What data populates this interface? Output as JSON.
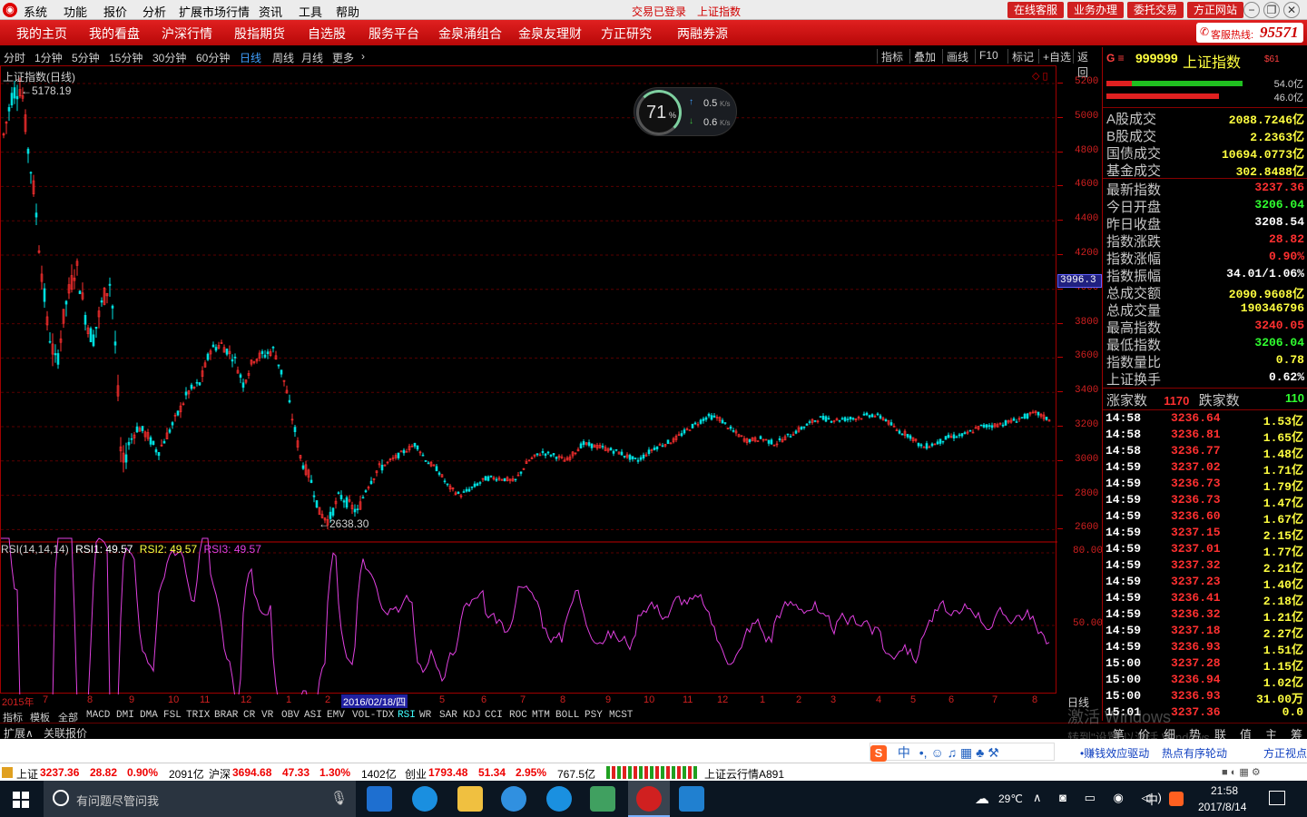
{
  "menubar": {
    "items": [
      "系统",
      "功能",
      "报价",
      "分析",
      "扩展市场行情",
      "资讯",
      "工具",
      "帮助"
    ],
    "status": "交易已登录",
    "title": "上证指数",
    "buttons": [
      "在线客服",
      "业务办理",
      "委托交易",
      "方正网站"
    ]
  },
  "navbar": {
    "items": [
      "我的主页",
      "我的看盘",
      "沪深行情",
      "股指期货",
      "自选股",
      "服务平台",
      "金泉涌组合",
      "金泉友理财",
      "方正研究",
      "两融券源"
    ],
    "hotline_label": "客服热线:",
    "hotline": "95571"
  },
  "periods": [
    "分时",
    "1分钟",
    "5分钟",
    "15分钟",
    "30分钟",
    "60分钟",
    "日线",
    "周线",
    "月线",
    "更多"
  ],
  "period_active": "日线",
  "tools": [
    "指标",
    "叠加",
    "画线",
    "F10",
    "标记",
    "+自选",
    "返回"
  ],
  "chart": {
    "title": "上证指数(日线)",
    "high_label": "5178.19",
    "low_label": "2638.30",
    "cursor_value": "3996.3",
    "y_ticks": [
      "5200",
      "5000",
      "4800",
      "4600",
      "4400",
      "4200",
      "4000",
      "3800",
      "3600",
      "3400",
      "3200",
      "3000",
      "2800",
      "2600"
    ],
    "rsi_title": "RSI(14,14,14)",
    "rsi1": "RSI1: 49.57",
    "rsi2": "RSI2: 49.57",
    "rsi3": "RSI3: 49.57",
    "rsi_ticks": [
      "80.00",
      "50.00"
    ],
    "date_labels": [
      "2015年",
      "7",
      "8",
      "9",
      "10",
      "11",
      "12",
      "1",
      "2",
      "2016/02/18/四",
      "5",
      "6",
      "7",
      "8",
      "9",
      "10",
      "11",
      "12",
      "1",
      "2",
      "3",
      "4",
      "5",
      "6",
      "7",
      "8"
    ],
    "period_footer": "日线"
  },
  "speed_widget": {
    "percent": "71",
    "unit": "%",
    "up": "0.5",
    "down": "0.6",
    "speed_unit": "K/s"
  },
  "indicators": [
    "指标",
    "模板",
    "全部",
    "MACD",
    "DMI",
    "DMA",
    "FSL",
    "TRIX",
    "BRAR",
    "CR",
    "VR",
    "OBV",
    "ASI",
    "EMV",
    "VOL-TDX",
    "RSI",
    "WR",
    "SAR",
    "KDJ",
    "CCI",
    "ROC",
    "MTM",
    "BOLL",
    "PSY",
    "MCST"
  ],
  "indicator_active": "RSI",
  "subtabs": [
    "扩展∧",
    "关联报价"
  ],
  "right_panel": {
    "code": "999999",
    "name": "上证指数",
    "tag": "$61",
    "bar_top": "54.0亿",
    "bar_bottom": "46.0亿",
    "rows1": [
      {
        "label": "A股成交",
        "value": "2088.7246亿"
      },
      {
        "label": "B股成交",
        "value": "2.2363亿"
      },
      {
        "label": "国债成交",
        "value": "10694.0773亿"
      },
      {
        "label": "基金成交",
        "value": "302.8488亿"
      }
    ],
    "rows2": [
      {
        "label": "最新指数",
        "value": "3237.36",
        "color": "#ff3030"
      },
      {
        "label": "今日开盘",
        "value": "3206.04",
        "color": "#30ff30"
      },
      {
        "label": "昨日收盘",
        "value": "3208.54",
        "color": "#ffffff"
      },
      {
        "label": "指数涨跌",
        "value": "28.82",
        "color": "#ff3030"
      },
      {
        "label": "指数涨幅",
        "value": "0.90%",
        "color": "#ff3030"
      },
      {
        "label": "指数振幅",
        "value": "34.01/1.06%",
        "color": "#ffffff"
      },
      {
        "label": "总成交额",
        "value": "2090.9608亿",
        "color": "#ffff40"
      },
      {
        "label": "总成交量",
        "value": "190346796",
        "color": "#ffff40"
      },
      {
        "label": "最高指数",
        "value": "3240.05",
        "color": "#ff3030"
      },
      {
        "label": "最低指数",
        "value": "3206.04",
        "color": "#30ff30"
      },
      {
        "label": "指数量比",
        "value": "0.78",
        "color": "#ffff40"
      },
      {
        "label": "上证换手",
        "value": "0.62%",
        "color": "#ffffff"
      }
    ],
    "up_label": "涨家数",
    "up_count": "1170",
    "down_label": "跌家数",
    "down_count": "110",
    "ticks": [
      {
        "time": "14:58",
        "price": "3236.64",
        "vol": "1.53亿"
      },
      {
        "time": "14:58",
        "price": "3236.81",
        "vol": "1.65亿"
      },
      {
        "time": "14:58",
        "price": "3236.77",
        "vol": "1.48亿"
      },
      {
        "time": "14:59",
        "price": "3237.02",
        "vol": "1.71亿"
      },
      {
        "time": "14:59",
        "price": "3236.73",
        "vol": "1.79亿"
      },
      {
        "time": "14:59",
        "price": "3236.73",
        "vol": "1.47亿"
      },
      {
        "time": "14:59",
        "price": "3236.60",
        "vol": "1.67亿"
      },
      {
        "time": "14:59",
        "price": "3237.15",
        "vol": "2.15亿"
      },
      {
        "time": "14:59",
        "price": "3237.01",
        "vol": "1.77亿"
      },
      {
        "time": "14:59",
        "price": "3237.32",
        "vol": "2.21亿"
      },
      {
        "time": "14:59",
        "price": "3237.23",
        "vol": "1.40亿"
      },
      {
        "time": "14:59",
        "price": "3236.41",
        "vol": "2.18亿"
      },
      {
        "time": "14:59",
        "price": "3236.32",
        "vol": "1.21亿"
      },
      {
        "time": "14:59",
        "price": "3237.18",
        "vol": "2.27亿"
      },
      {
        "time": "14:59",
        "price": "3236.93",
        "vol": "1.51亿"
      },
      {
        "time": "15:00",
        "price": "3237.28",
        "vol": "1.15亿"
      },
      {
        "time": "15:00",
        "price": "3236.94",
        "vol": "1.02亿"
      },
      {
        "time": "15:00",
        "price": "3236.93",
        "vol": "31.00万"
      },
      {
        "time": "15:01",
        "price": "3237.36",
        "vol": "0.0"
      }
    ],
    "tabs": [
      "笔",
      "价",
      "细",
      "势",
      "联",
      "值",
      "主",
      "筹"
    ]
  },
  "links": [
    "•赚钱效应驱动",
    "热点有序轮动",
    "方正视点"
  ],
  "ticker": [
    {
      "name": "上证",
      "value": "3237.36",
      "change": "28.82",
      "pct": "0.90%",
      "amount": "2091亿"
    },
    {
      "name": "沪深",
      "value": "3694.68",
      "change": "47.33",
      "pct": "1.30%",
      "amount": "1402亿"
    },
    {
      "name": "创业",
      "value": "1793.48",
      "change": "51.34",
      "pct": "2.95%",
      "amount": "767.5亿"
    }
  ],
  "ticker_right": "上证云行情A891",
  "watermark": [
    "激活 Windows",
    "转到\"设置\"以激活 Windows。"
  ],
  "taskbar": {
    "search_placeholder": "有问题尽管问我",
    "weather": "29℃",
    "ime": "中",
    "time": "21:58",
    "date": "2017/8/14"
  },
  "colors": {
    "up": "#ff3030",
    "down": "#00e0e0",
    "rsi": "#e040e0",
    "axis": "#c00000",
    "grid": "#5a0000"
  }
}
